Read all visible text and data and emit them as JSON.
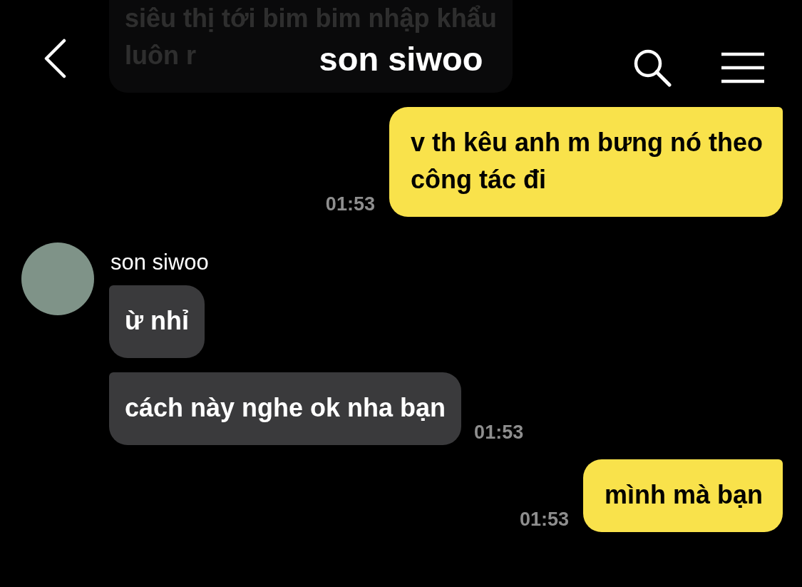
{
  "header": {
    "title": "son siwoo"
  },
  "messages": [
    {
      "kind": "received",
      "text": "siêu thị tới bim bim nhập khẩu\nluôn r"
    },
    {
      "kind": "sent",
      "text": "v th kêu anh m bưng nó theo\ncông tác đi",
      "time": "01:53"
    },
    {
      "kind": "received",
      "sender": "son siwoo",
      "text": "ừ nhỉ"
    },
    {
      "kind": "received",
      "text": "cách này nghe ok nha bạn",
      "time": "01:53"
    },
    {
      "kind": "sent",
      "text": "mình mà bạn",
      "time": "01:53"
    }
  ]
}
